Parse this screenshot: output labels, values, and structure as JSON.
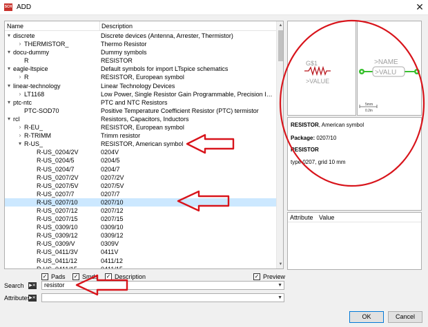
{
  "window": {
    "title": "ADD",
    "icon_text": "SCH",
    "close_glyph": "✕"
  },
  "tree": {
    "columns": {
      "name": "Name",
      "description": "Description"
    },
    "rows": [
      {
        "name": "discrete",
        "desc": "Discrete devices (Antenna, Arrester, Thermistor)",
        "level": 0,
        "exp": "open"
      },
      {
        "name": "THERMISTOR_",
        "desc": "Thermo Resistor",
        "level": 1,
        "exp": "closed"
      },
      {
        "name": "docu-dummy",
        "desc": "Dummy symbols",
        "level": 0,
        "exp": "open"
      },
      {
        "name": "R",
        "desc": "RESISTOR",
        "level": 1,
        "exp": "none"
      },
      {
        "name": "eagle-ltspice",
        "desc": "Default symbols for import LTspice schematics",
        "level": 0,
        "exp": "open"
      },
      {
        "name": "R",
        "desc": "RESISTOR, European symbol",
        "level": 1,
        "exp": "closed"
      },
      {
        "name": "linear-technology",
        "desc": "Linear Technology Devices",
        "level": 0,
        "exp": "open"
      },
      {
        "name": "LT1168",
        "desc": "Low Power, Single Resistor Gain Programmable, Precision Instrum...",
        "level": 1,
        "exp": "closed"
      },
      {
        "name": "ptc-ntc",
        "desc": "PTC and NTC Resistors",
        "level": 0,
        "exp": "open"
      },
      {
        "name": "PTC-SOD70",
        "desc": "Positive Temperature Coefficient Resistor (PTC) termistor",
        "level": 1,
        "exp": "none"
      },
      {
        "name": "rcl",
        "desc": "Resistors, Capacitors, Inductors",
        "level": 0,
        "exp": "open"
      },
      {
        "name": "R-EU_",
        "desc": "RESISTOR, European symbol",
        "level": 1,
        "exp": "closed"
      },
      {
        "name": "R-TRIMM",
        "desc": "Trimm resistor",
        "level": 1,
        "exp": "closed"
      },
      {
        "name": "R-US_",
        "desc": "RESISTOR, American symbol",
        "level": 1,
        "exp": "open"
      },
      {
        "name": "R-US_0204/2V",
        "desc": "0204V",
        "level": 2,
        "exp": "none"
      },
      {
        "name": "R-US_0204/5",
        "desc": "0204/5",
        "level": 2,
        "exp": "none"
      },
      {
        "name": "R-US_0204/7",
        "desc": "0204/7",
        "level": 2,
        "exp": "none"
      },
      {
        "name": "R-US_0207/2V",
        "desc": "0207/2V",
        "level": 2,
        "exp": "none"
      },
      {
        "name": "R-US_0207/5V",
        "desc": "0207/5V",
        "level": 2,
        "exp": "none"
      },
      {
        "name": "R-US_0207/7",
        "desc": "0207/7",
        "level": 2,
        "exp": "none"
      },
      {
        "name": "R-US_0207/10",
        "desc": "0207/10",
        "level": 2,
        "exp": "none",
        "selected": true
      },
      {
        "name": "R-US_0207/12",
        "desc": "0207/12",
        "level": 2,
        "exp": "none"
      },
      {
        "name": "R-US_0207/15",
        "desc": "0207/15",
        "level": 2,
        "exp": "none"
      },
      {
        "name": "R-US_0309/10",
        "desc": "0309/10",
        "level": 2,
        "exp": "none"
      },
      {
        "name": "R-US_0309/12",
        "desc": "0309/12",
        "level": 2,
        "exp": "none"
      },
      {
        "name": "R-US_0309/V",
        "desc": "0309V",
        "level": 2,
        "exp": "none"
      },
      {
        "name": "R-US_0411/3V",
        "desc": "0411V",
        "level": 2,
        "exp": "none"
      },
      {
        "name": "R-US_0411/12",
        "desc": "0411/12",
        "level": 2,
        "exp": "none"
      },
      {
        "name": "R-US_0411/15",
        "desc": "0411/15",
        "level": 2,
        "exp": "none"
      }
    ]
  },
  "options": {
    "pads": {
      "label": "Pads",
      "checked": true
    },
    "smds": {
      "label": "Smds",
      "checked": true
    },
    "description": {
      "label": "Description",
      "checked": true
    },
    "preview": {
      "label": "Preview",
      "checked": true
    }
  },
  "search": {
    "label": "Search",
    "value": "resistor"
  },
  "attributes": {
    "label": "Attributes",
    "value": ""
  },
  "preview": {
    "symbol": {
      "name": "G$1",
      "value": ">VALUE"
    },
    "package": {
      "name": ">NAME",
      "value": ">VALU",
      "scale_top": "5mm",
      "scale_bottom": "0.2in"
    },
    "description": {
      "title_bold": "RESISTOR",
      "title_rest": ", American symbol",
      "package_label": "Package:",
      "package_value": "0207/10",
      "device_bold": "RESISTOR",
      "device_detail": "type 0207, grid 10 mm"
    },
    "attributes": {
      "col_attribute": "Attribute",
      "col_value": "Value"
    }
  },
  "buttons": {
    "ok": "OK",
    "cancel": "Cancel"
  },
  "colors": {
    "selection": "#cce8ff",
    "annotation": "#d8141b",
    "resistor_symbol": "#b8141b",
    "pad_green": "#37c02d"
  }
}
